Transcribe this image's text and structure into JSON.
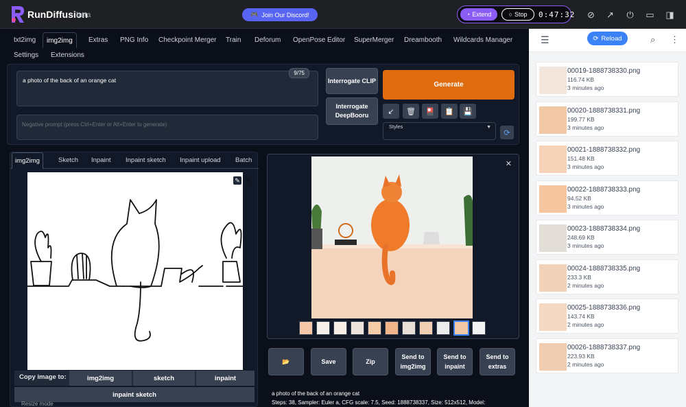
{
  "app": {
    "brand": "RunDiffusion",
    "badge": "beta",
    "discord_label": "Join Our Discord!",
    "extend_label": "Extend",
    "stop_label": "Stop",
    "timer": "0:47:32"
  },
  "top_tabs": [
    "txt2img",
    "img2img",
    "Extras",
    "PNG Info",
    "Checkpoint Merger",
    "Train",
    "Deforum",
    "OpenPose Editor",
    "SuperMerger",
    "Dreambooth",
    "Wildcards Manager",
    "Settings",
    "Extensions"
  ],
  "active_top_tab": "img2img",
  "prompt": {
    "value": "a photo of the back of an orange cat",
    "counter": "9/75",
    "negative_placeholder": "Negative prompt (press Ctrl+Enter or Alt+Enter to generate)"
  },
  "buttons": {
    "interrogate_clip": "Interrogate CLIP",
    "interrogate_deepbooru": "Interrogate DeepBooru",
    "generate": "Generate",
    "styles_label": "Styles"
  },
  "sub_tabs": [
    "img2img",
    "Sketch",
    "Inpaint",
    "Inpaint sketch",
    "Inpaint upload",
    "Batch"
  ],
  "copy_row": {
    "label": "Copy image to:",
    "targets": [
      "img2img",
      "sketch",
      "inpaint"
    ],
    "wide": "inpaint sketch"
  },
  "resize_mode_label": "Resize mode",
  "output_actions": [
    "📂",
    "Save",
    "Zip",
    "Send to img2img",
    "Send to inpaint",
    "Send to extras"
  ],
  "generation_info": {
    "prompt": "a photo of the back of an orange cat",
    "params": "Steps: 38, Sampler: Euler a, CFG scale: 7.5, Seed: 1888738337, Size: 512x512, Model:"
  },
  "sidebar": {
    "reload_label": "Reload",
    "files": [
      {
        "name": "00019-1888738330.png",
        "size": "116.74 KB",
        "time": "3 minutes ago"
      },
      {
        "name": "00020-1888738331.png",
        "size": "199.77 KB",
        "time": "3 minutes ago"
      },
      {
        "name": "00021-1888738332.png",
        "size": "151.48 KB",
        "time": "3 minutes ago"
      },
      {
        "name": "00022-1888738333.png",
        "size": "94.52 KB",
        "time": "3 minutes ago"
      },
      {
        "name": "00023-1888738334.png",
        "size": "248.69 KB",
        "time": "3 minutes ago"
      },
      {
        "name": "00024-1888738335.png",
        "size": "233.3 KB",
        "time": "2 minutes ago"
      },
      {
        "name": "00025-1888738336.png",
        "size": "143.74 KB",
        "time": "2 minutes ago"
      },
      {
        "name": "00026-1888738337.png",
        "size": "223.93 KB",
        "time": "2 minutes ago"
      }
    ]
  },
  "colors": {
    "accent": "#e06c10",
    "brand": "#8b5cf6",
    "link": "#3b82f6"
  }
}
